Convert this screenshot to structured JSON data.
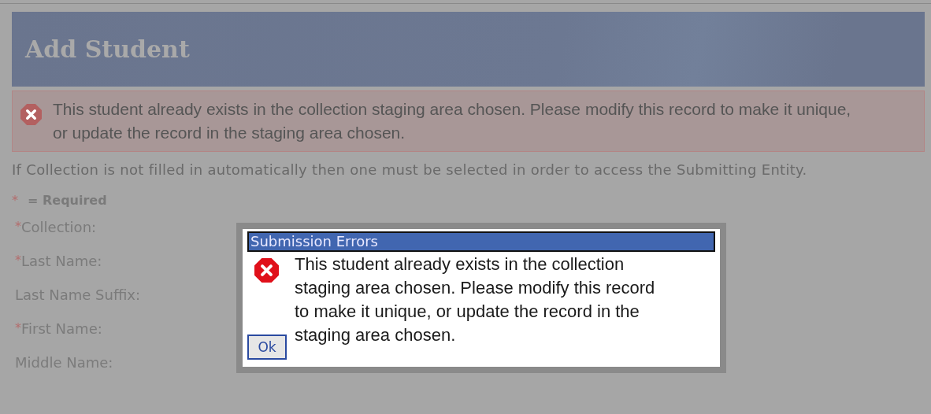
{
  "page": {
    "title": "Add Student"
  },
  "error_banner": {
    "message": "This student already exists in the collection staging area chosen. Please modify this record to make it unique, or update the record in the staging area chosen."
  },
  "info_text": "If Collection is not filled in automatically then one must be selected in order to access the Submitting Entity.",
  "legend": {
    "mark": "*",
    "text": "= Required"
  },
  "fields": [
    {
      "label": "Collection:",
      "required": true
    },
    {
      "label": "Last Name:",
      "required": true
    },
    {
      "label": "Last Name Suffix:",
      "required": false
    },
    {
      "label": "First Name:",
      "required": true
    },
    {
      "label": "Middle Name:",
      "required": false
    }
  ],
  "dialog": {
    "title": "Submission Errors",
    "message": "This student already exists in the collection staging area chosen. Please modify this record to make it unique, or update the record in the staging area chosen.",
    "button": "Ok"
  }
}
